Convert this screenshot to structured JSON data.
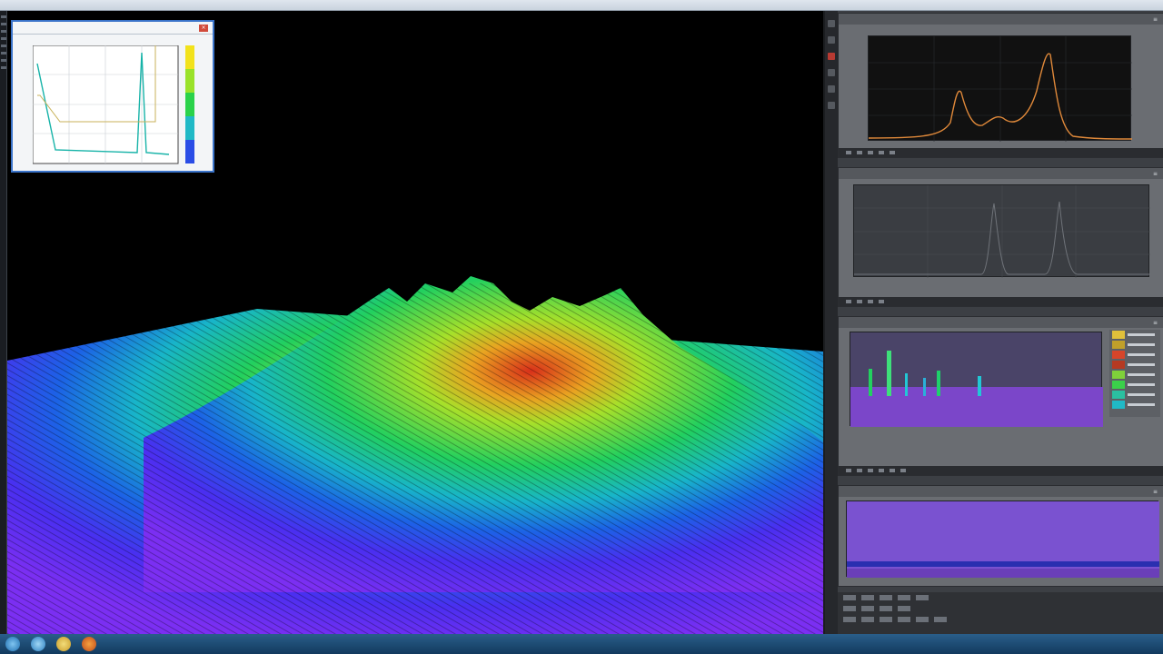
{
  "menubar": {
    "items": [
      "",
      "",
      "",
      "",
      ""
    ]
  },
  "inset": {
    "title": "",
    "x_label": ""
  },
  "viewport": {
    "label": ""
  },
  "panels": {
    "spectrum": {
      "title": ""
    },
    "overview": {
      "title": ""
    },
    "layers": {
      "title": ""
    },
    "timeline": {
      "title": ""
    }
  },
  "taskbar": {
    "clock": ""
  },
  "colors": {
    "surface_low": "#7b2ff2",
    "surface_mid": "#1fd06b",
    "surface_peak": "#e4471b",
    "window_accent": "#3a73c9",
    "spectrum_curve": "#e0893a"
  },
  "icons": {
    "start": "windows-orb-icon",
    "browser": "browser-icon",
    "folder": "folder-icon",
    "media": "media-player-icon",
    "close": "close-icon"
  }
}
